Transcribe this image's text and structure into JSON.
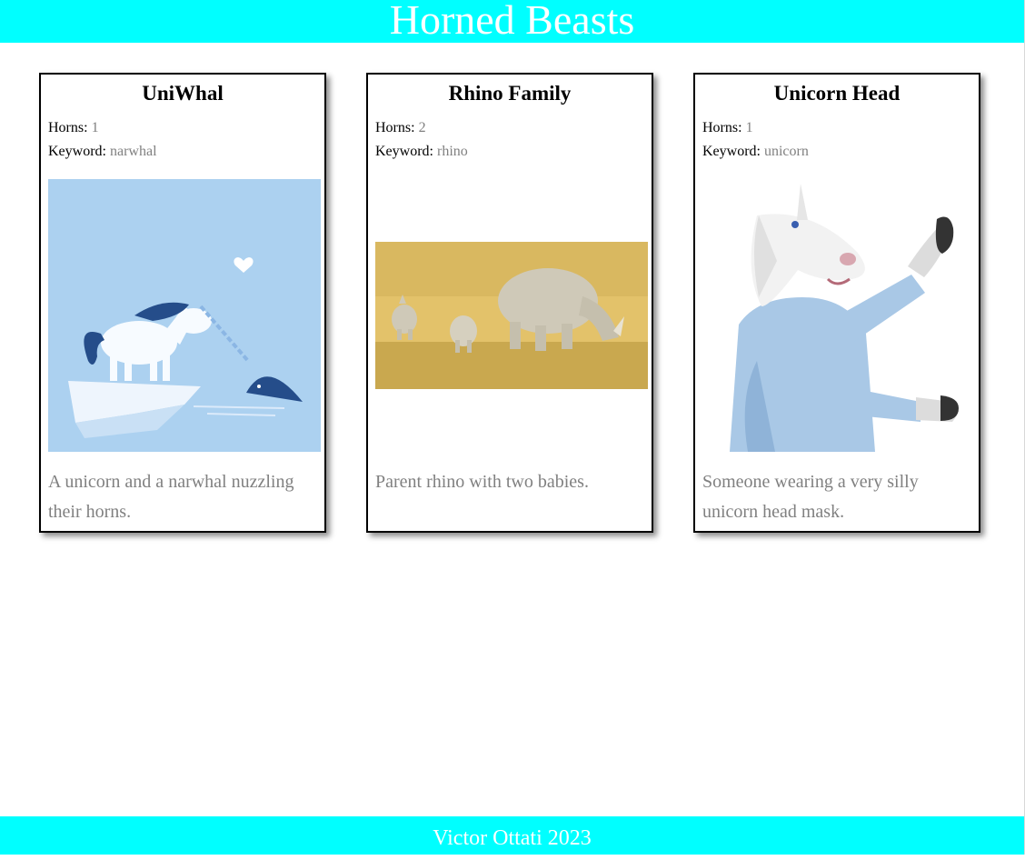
{
  "header": {
    "title": "Horned Beasts"
  },
  "labels": {
    "horns": "Horns:",
    "keyword": "Keyword:"
  },
  "beasts": [
    {
      "title": "UniWhal",
      "horns": "1",
      "keyword": "narwhal",
      "description": "A unicorn and a narwhal nuzzling their horns."
    },
    {
      "title": "Rhino Family",
      "horns": "2",
      "keyword": "rhino",
      "description": "Parent rhino with two babies."
    },
    {
      "title": "Unicorn Head",
      "horns": "1",
      "keyword": "unicorn",
      "description": "Someone wearing a very silly unicorn head mask."
    }
  ],
  "footer": {
    "text": "Victor Ottati 2023"
  },
  "colors": {
    "banner": "#00ffff",
    "muted": "#808080"
  }
}
